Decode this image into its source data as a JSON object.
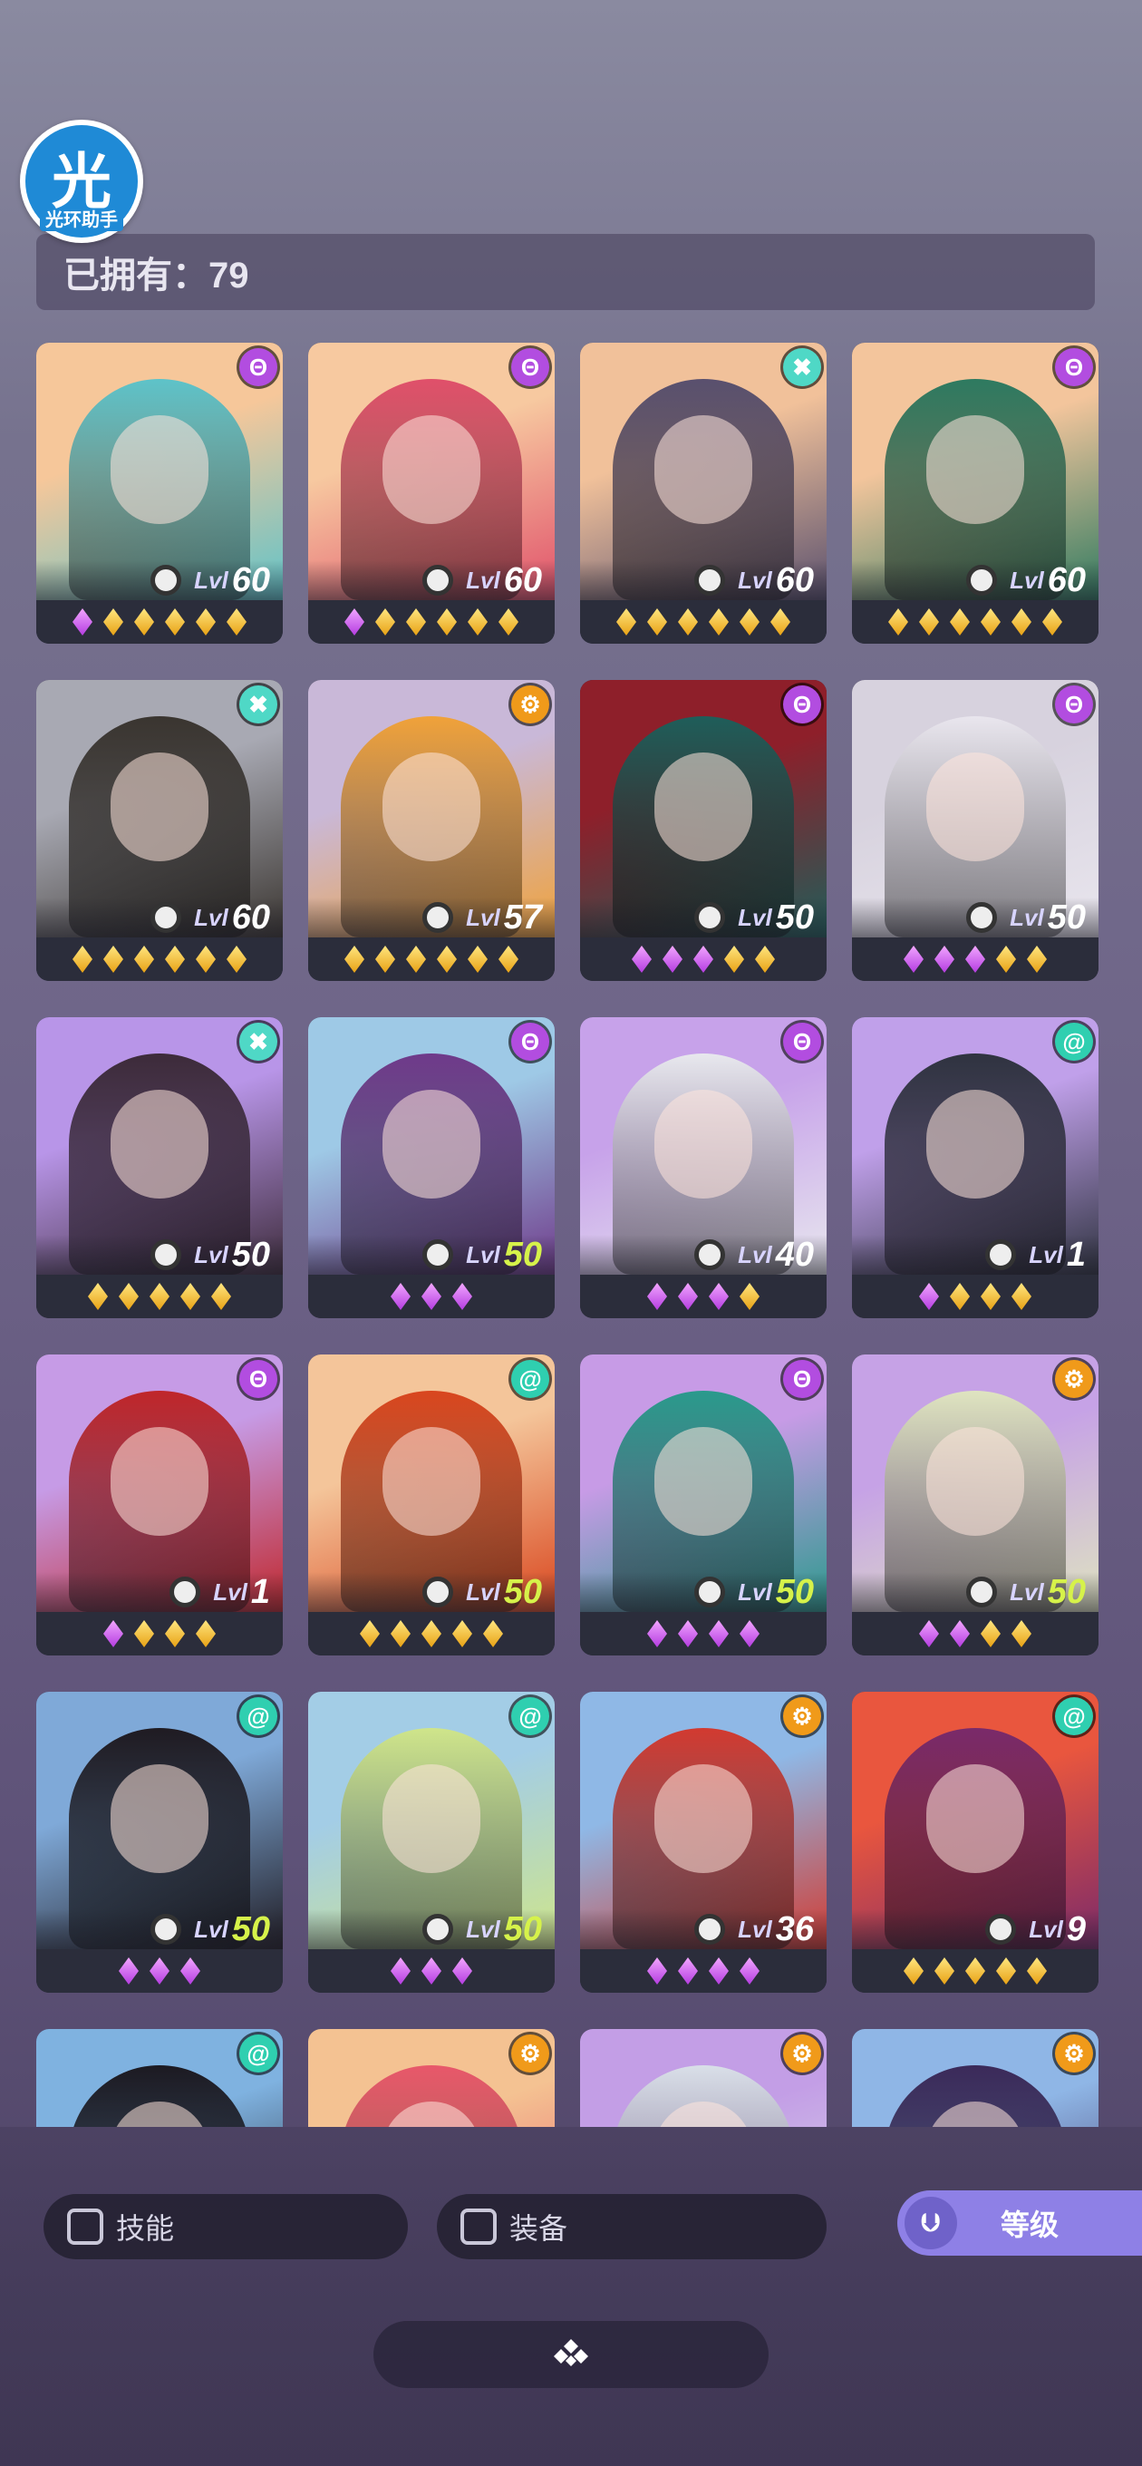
{
  "app_logo": {
    "glyph": "光",
    "text": "光环助手"
  },
  "owned": {
    "label": "已拥有：79"
  },
  "colors": {
    "gold_star": "#f2b02a",
    "purple_star": "#c65cf0",
    "class_purple": "#b24de0",
    "class_cyan": "#4fd8c6",
    "class_orange": "#f09a1a",
    "level_highlight": "#d6f24a",
    "sort_button": "#8e80e6"
  },
  "heroes": [
    {
      "level_prefix": "Lvl",
      "level": "60",
      "highlight": false,
      "class_icon": "purple-eye-icon",
      "stars": [
        "purple",
        "gold",
        "gold",
        "gold",
        "gold",
        "gold"
      ],
      "art": [
        "#f6c79a",
        "#5ec3c9"
      ]
    },
    {
      "level_prefix": "Lvl",
      "level": "60",
      "highlight": false,
      "class_icon": "purple-eye-icon",
      "stars": [
        "purple",
        "gold",
        "gold",
        "gold",
        "gold",
        "gold"
      ],
      "art": [
        "#f7c9a0",
        "#e0506a"
      ]
    },
    {
      "level_prefix": "Lvl",
      "level": "60",
      "highlight": false,
      "class_icon": "cyan-cross-icon",
      "stars": [
        "gold",
        "gold",
        "gold",
        "gold",
        "gold",
        "gold"
      ],
      "art": [
        "#f1c19a",
        "#59506e"
      ]
    },
    {
      "level_prefix": "Lvl",
      "level": "60",
      "highlight": false,
      "class_icon": "purple-eye-icon",
      "stars": [
        "gold",
        "gold",
        "gold",
        "gold",
        "gold",
        "gold"
      ],
      "art": [
        "#f3c59c",
        "#2e7a60"
      ]
    },
    {
      "level_prefix": "Lvl",
      "level": "60",
      "highlight": false,
      "class_icon": "cyan-cross-icon",
      "stars": [
        "gold",
        "gold",
        "gold",
        "gold",
        "gold",
        "gold"
      ],
      "art": [
        "#a8a9b3",
        "#3a3530"
      ]
    },
    {
      "level_prefix": "Lvl",
      "level": "57",
      "highlight": false,
      "class_icon": "orange-gear-icon",
      "stars": [
        "gold",
        "gold",
        "gold",
        "gold",
        "gold",
        "gold"
      ],
      "art": [
        "#c9b8d8",
        "#f0a23a"
      ]
    },
    {
      "level_prefix": "Lvl",
      "level": "50",
      "highlight": false,
      "class_icon": "purple-eye-icon",
      "stars": [
        "purple",
        "purple",
        "purple",
        "gold",
        "gold"
      ],
      "art": [
        "#8e1f2a",
        "#1f5e5a"
      ]
    },
    {
      "level_prefix": "Lvl",
      "level": "50",
      "highlight": false,
      "class_icon": "purple-eye-icon",
      "stars": [
        "purple",
        "purple",
        "purple",
        "gold",
        "gold"
      ],
      "art": [
        "#d7d2de",
        "#e9e6ee"
      ]
    },
    {
      "level_prefix": "Lvl",
      "level": "50",
      "highlight": false,
      "class_icon": "cyan-cross-icon",
      "stars": [
        "gold",
        "gold",
        "gold",
        "gold",
        "gold"
      ],
      "art": [
        "#b895e8",
        "#3d2b3a"
      ]
    },
    {
      "level_prefix": "Lvl",
      "level": "50",
      "highlight": true,
      "class_icon": "purple-eye-icon",
      "stars": [
        "purple",
        "purple",
        "purple"
      ],
      "art": [
        "#9ec9e6",
        "#6f3a8a"
      ]
    },
    {
      "level_prefix": "Lvl",
      "level": "40",
      "highlight": false,
      "class_icon": "purple-eye-icon",
      "stars": [
        "purple",
        "purple",
        "purple",
        "gold"
      ],
      "art": [
        "#c7a2ea",
        "#e8e8ee"
      ]
    },
    {
      "level_prefix": "Lvl",
      "level": "1",
      "highlight": false,
      "class_icon": "cyan-swirl-icon",
      "stars": [
        "purple",
        "gold",
        "gold",
        "gold"
      ],
      "art": [
        "#c0a0ea",
        "#2f3340"
      ]
    },
    {
      "level_prefix": "Lvl",
      "level": "1",
      "highlight": false,
      "class_icon": "purple-eye-icon",
      "stars": [
        "purple",
        "gold",
        "gold",
        "gold"
      ],
      "art": [
        "#c69be6",
        "#c0262a"
      ]
    },
    {
      "level_prefix": "Lvl",
      "level": "50",
      "highlight": true,
      "class_icon": "cyan-swirl-icon",
      "stars": [
        "gold",
        "gold",
        "gold",
        "gold",
        "gold"
      ],
      "art": [
        "#f4c59a",
        "#d9461e"
      ]
    },
    {
      "level_prefix": "Lvl",
      "level": "50",
      "highlight": true,
      "class_icon": "purple-eye-icon",
      "stars": [
        "purple",
        "purple",
        "purple",
        "purple"
      ],
      "art": [
        "#c79be6",
        "#2a9a8c"
      ]
    },
    {
      "level_prefix": "Lvl",
      "level": "50",
      "highlight": true,
      "class_icon": "orange-gear-icon",
      "stars": [
        "purple",
        "purple",
        "gold",
        "gold"
      ],
      "art": [
        "#c6a2e6",
        "#dfe4c0"
      ]
    },
    {
      "level_prefix": "Lvl",
      "level": "50",
      "highlight": true,
      "class_icon": "cyan-swirl-icon",
      "stars": [
        "purple",
        "purple",
        "purple"
      ],
      "art": [
        "#7fa9d8",
        "#1f1b22"
      ]
    },
    {
      "level_prefix": "Lvl",
      "level": "50",
      "highlight": true,
      "class_icon": "cyan-swirl-icon",
      "stars": [
        "purple",
        "purple",
        "purple"
      ],
      "art": [
        "#a3cde6",
        "#cfe58a"
      ]
    },
    {
      "level_prefix": "Lvl",
      "level": "36",
      "highlight": false,
      "class_icon": "orange-gear-icon",
      "stars": [
        "purple",
        "purple",
        "purple",
        "purple"
      ],
      "art": [
        "#8fb8e6",
        "#d23a30"
      ]
    },
    {
      "level_prefix": "Lvl",
      "level": "9",
      "highlight": false,
      "class_icon": "cyan-swirl-icon",
      "stars": [
        "gold",
        "gold",
        "gold",
        "gold",
        "gold"
      ],
      "art": [
        "#e9563e",
        "#7a2a6a"
      ]
    },
    {
      "level_prefix": "",
      "level": "",
      "highlight": false,
      "class_icon": "cyan-swirl-icon",
      "stars": [],
      "art": [
        "#7fb2e0",
        "#1c1a22"
      ]
    },
    {
      "level_prefix": "",
      "level": "",
      "highlight": false,
      "class_icon": "orange-gear-icon",
      "stars": [],
      "art": [
        "#f4c292",
        "#e8586a"
      ]
    },
    {
      "level_prefix": "",
      "level": "",
      "highlight": false,
      "class_icon": "orange-gear-icon",
      "stars": [],
      "art": [
        "#c39ee6",
        "#d9dfe8"
      ]
    },
    {
      "level_prefix": "",
      "level": "",
      "highlight": false,
      "class_icon": "orange-gear-icon",
      "stars": [],
      "art": [
        "#8fb6e6",
        "#3b2a5a"
      ]
    }
  ],
  "filters": {
    "skill": {
      "label": "技能",
      "checked": false
    },
    "equipment": {
      "label": "装备",
      "checked": false
    }
  },
  "sort": {
    "label": "等级"
  }
}
